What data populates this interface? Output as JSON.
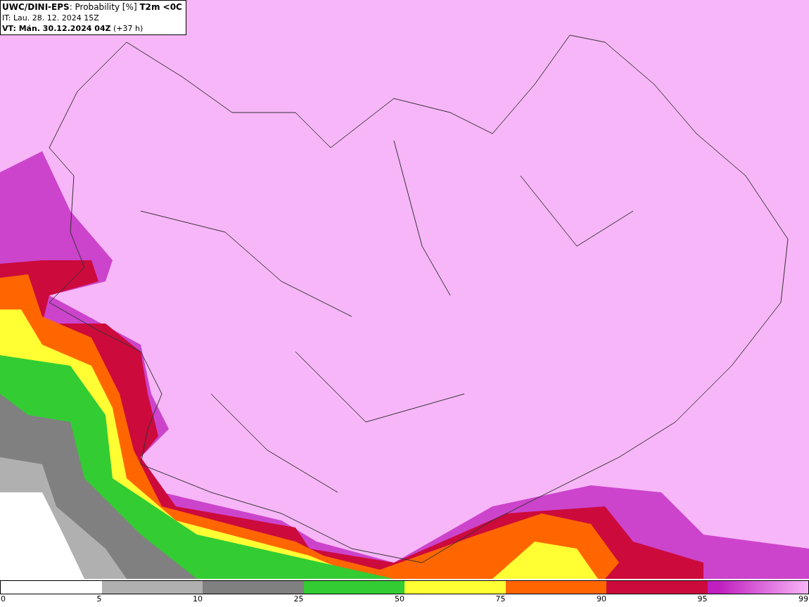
{
  "header": {
    "lines": [
      "**UWC/DINI-EPS**: Probability [%] **T2m <0C**",
      "IT: Lau. 28. 12. 2024 15Z",
      "**VT: Mán. 30.12.2024 04Z** (+37 h)"
    ]
  },
  "legend": {
    "segments": [
      {
        "color": "#ffffff"
      },
      {
        "color": "#b0b0b0"
      },
      {
        "color": "#808080"
      },
      {
        "color": "#33cc33"
      },
      {
        "color": "#ffff33"
      },
      {
        "color": "#ff6600"
      },
      {
        "color": "#cc0a3c"
      },
      {
        "color": "#c020c0"
      }
    ],
    "labels": [
      "0",
      "5",
      "10",
      "25",
      "50",
      "75",
      "90",
      "95",
      "99"
    ]
  }
}
